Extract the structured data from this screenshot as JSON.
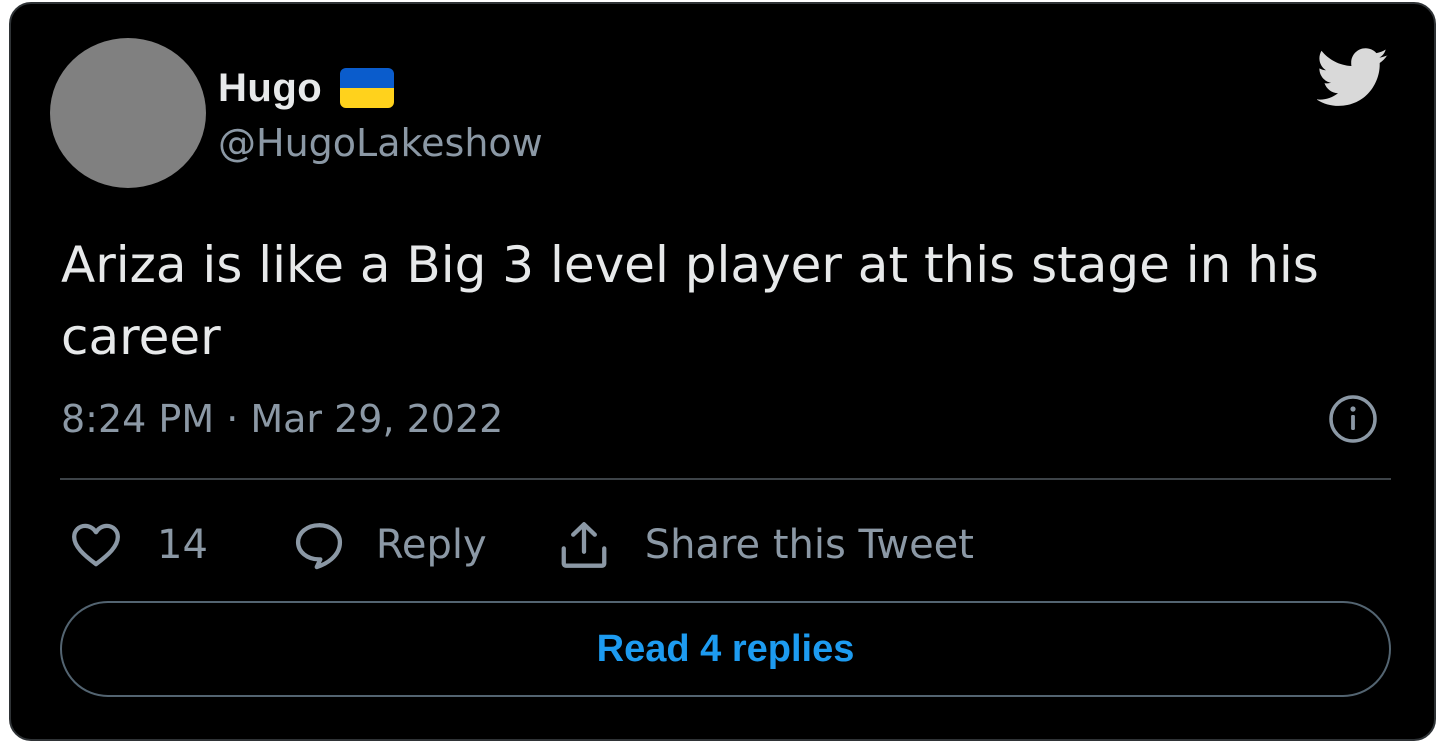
{
  "author": {
    "display_name": "Hugo",
    "flag_icon": "ukraine-flag-icon",
    "handle": "@HugoLakeshow"
  },
  "tweet": {
    "text": "Ariza is like a Big 3 level player at this stage in his career",
    "timestamp": "8:24 PM · Mar 29, 2022"
  },
  "actions": {
    "like_count": "14",
    "reply_label": "Reply",
    "share_label": "Share this Tweet"
  },
  "read_replies_label": "Read 4 replies",
  "colors": {
    "background": "#000000",
    "primary_text": "#e7e9ea",
    "secondary_text": "#8b98a5",
    "accent": "#1d9bf0",
    "flag_blue": "#0a5ccc",
    "flag_yellow": "#ffd21c"
  }
}
